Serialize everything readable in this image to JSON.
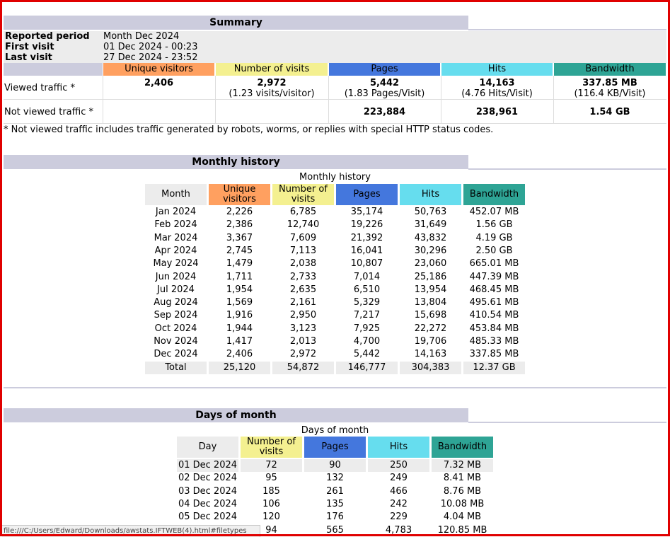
{
  "summary": {
    "title": "Summary",
    "reported_period_label": "Reported period",
    "reported_period_value": "Month Dec 2024",
    "first_visit_label": "First visit",
    "first_visit_value": "01 Dec 2024 - 00:23",
    "last_visit_label": "Last visit",
    "last_visit_value": "27 Dec 2024 - 23:52",
    "headers": {
      "unique_visitors": "Unique visitors",
      "number_of_visits": "Number of visits",
      "pages": "Pages",
      "hits": "Hits",
      "bandwidth": "Bandwidth"
    },
    "viewed": {
      "label": "Viewed traffic *",
      "unique_visitors": "2,406",
      "visits": "2,972",
      "visits_sub": "(1.23 visits/visitor)",
      "pages": "5,442",
      "pages_sub": "(1.83 Pages/Visit)",
      "hits": "14,163",
      "hits_sub": "(4.76 Hits/Visit)",
      "bandwidth": "337.85 MB",
      "bandwidth_sub": "(116.4 KB/Visit)"
    },
    "not_viewed": {
      "label": "Not viewed traffic *",
      "pages": "223,884",
      "hits": "238,961",
      "bandwidth": "1.54 GB"
    },
    "note": "* Not viewed traffic includes traffic generated by robots, worms, or replies with special HTTP status codes."
  },
  "monthly": {
    "title": "Monthly history",
    "caption": "Monthly history",
    "headers": {
      "month": "Month",
      "unique_visitors": "Unique visitors",
      "number_of_visits": "Number of visits",
      "pages": "Pages",
      "hits": "Hits",
      "bandwidth": "Bandwidth"
    },
    "rows": [
      [
        "Jan 2024",
        "2,226",
        "6,785",
        "35,174",
        "50,763",
        "452.07 MB"
      ],
      [
        "Feb 2024",
        "2,386",
        "12,740",
        "19,226",
        "31,649",
        "1.56 GB"
      ],
      [
        "Mar 2024",
        "3,367",
        "7,609",
        "21,392",
        "43,832",
        "4.19 GB"
      ],
      [
        "Apr 2024",
        "2,745",
        "7,113",
        "16,041",
        "30,296",
        "2.50 GB"
      ],
      [
        "May 2024",
        "1,479",
        "2,038",
        "10,807",
        "23,060",
        "665.01 MB"
      ],
      [
        "Jun 2024",
        "1,711",
        "2,733",
        "7,014",
        "25,186",
        "447.39 MB"
      ],
      [
        "Jul 2024",
        "1,954",
        "2,635",
        "6,510",
        "13,954",
        "468.45 MB"
      ],
      [
        "Aug 2024",
        "1,569",
        "2,161",
        "5,329",
        "13,804",
        "495.61 MB"
      ],
      [
        "Sep 2024",
        "1,916",
        "2,950",
        "7,217",
        "15,698",
        "410.54 MB"
      ],
      [
        "Oct 2024",
        "1,944",
        "3,123",
        "7,925",
        "22,272",
        "453.84 MB"
      ],
      [
        "Nov 2024",
        "1,417",
        "2,013",
        "4,700",
        "19,706",
        "485.33 MB"
      ],
      [
        "Dec 2024",
        "2,406",
        "2,972",
        "5,442",
        "14,163",
        "337.85 MB"
      ]
    ],
    "total": [
      "Total",
      "25,120",
      "54,872",
      "146,777",
      "304,383",
      "12.37 GB"
    ]
  },
  "days": {
    "title": "Days of month",
    "caption": "Days of month",
    "headers": {
      "day": "Day",
      "number_of_visits": "Number of visits",
      "pages": "Pages",
      "hits": "Hits",
      "bandwidth": "Bandwidth"
    },
    "rows": [
      [
        "01 Dec 2024",
        "72",
        "90",
        "250",
        "7.32 MB"
      ],
      [
        "02 Dec 2024",
        "95",
        "132",
        "249",
        "8.41 MB"
      ],
      [
        "03 Dec 2024",
        "185",
        "261",
        "466",
        "8.76 MB"
      ],
      [
        "04 Dec 2024",
        "106",
        "135",
        "242",
        "10.08 MB"
      ],
      [
        "05 Dec 2024",
        "120",
        "176",
        "229",
        "4.04 MB"
      ],
      [
        "",
        "94",
        "565",
        "4,783",
        "120.85 MB"
      ]
    ]
  },
  "status_bar": {
    "url": "file:///C:/Users/Edward/Downloads/awstats.IFTWEB(4).html#filetypes"
  },
  "colors": {
    "section_header": "#ccccdd",
    "unique_visitors": "#ffa060",
    "visits": "#f4f090",
    "pages": "#4477dd",
    "hits": "#66ddee",
    "bandwidth": "#2ea495",
    "window_frame": "#e00000"
  }
}
